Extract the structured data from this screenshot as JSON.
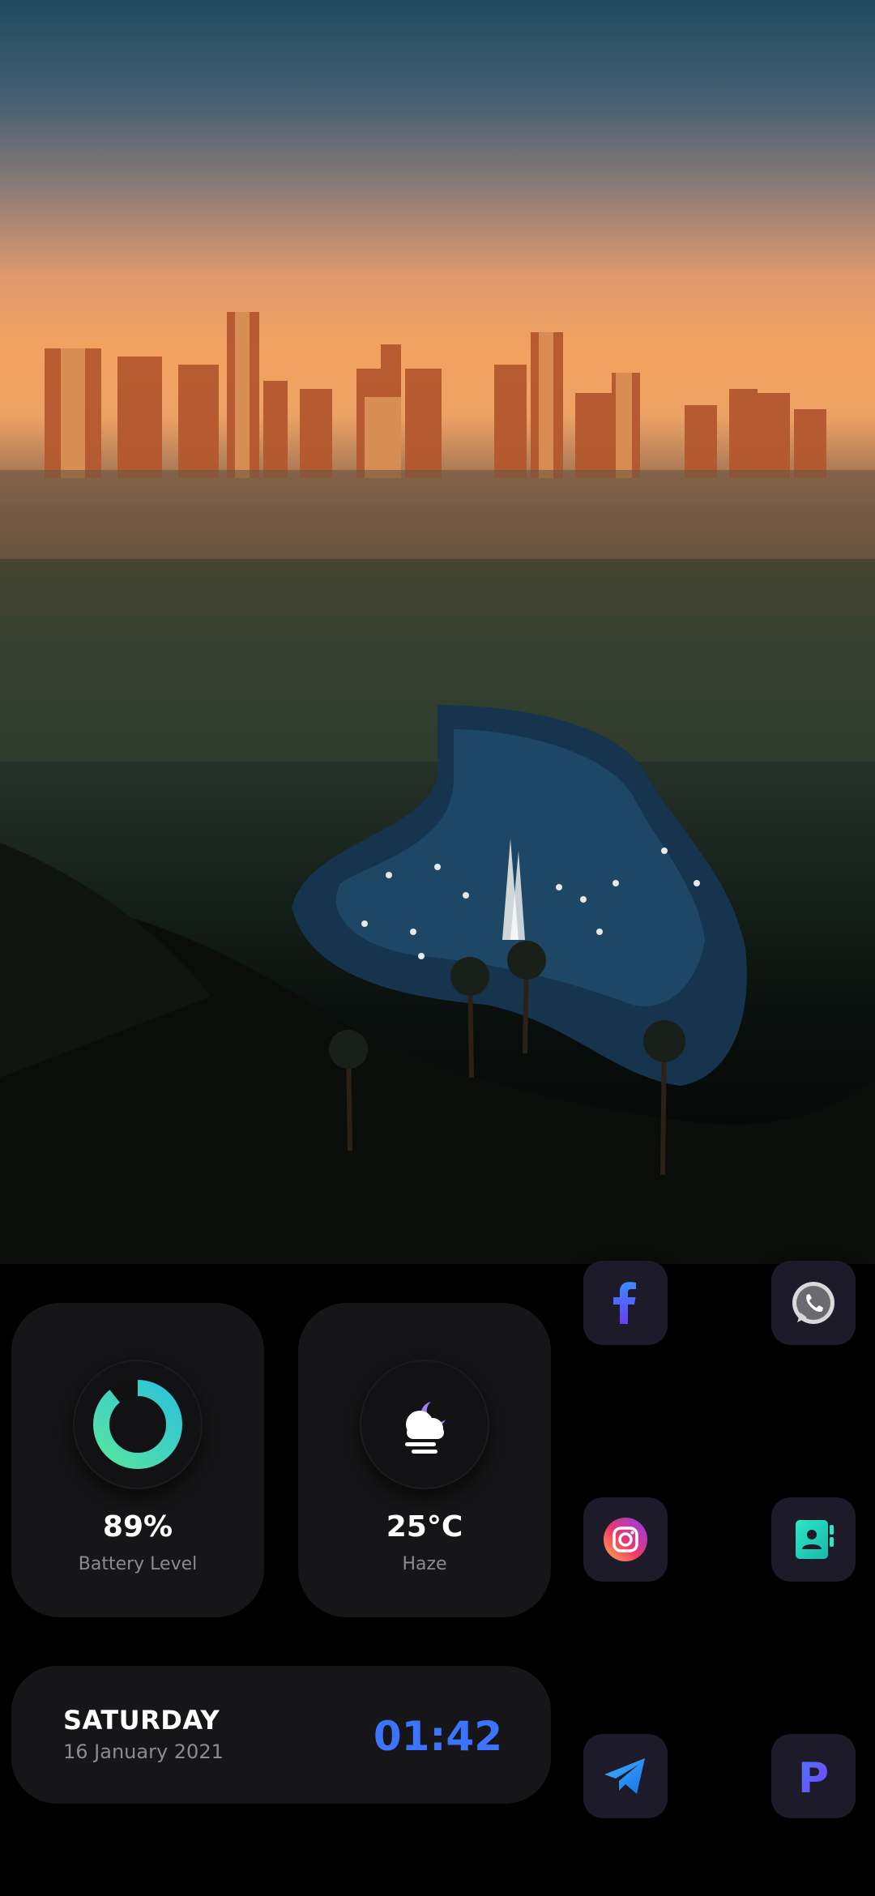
{
  "widgets": {
    "battery": {
      "percent_text": "89%",
      "label": "Battery Level",
      "level": 0.89,
      "accent_from": "#57e3a2",
      "accent_to": "#2ec3d9"
    },
    "weather": {
      "temp": "25°C",
      "condition": "Haze",
      "icon": "cloud-moon-haze-icon"
    },
    "datetime": {
      "day": "SATURDAY",
      "date": "16 January 2021",
      "time": "01:42",
      "time_color": "#3a74ff"
    }
  },
  "apps": [
    {
      "name": "Facebook",
      "icon": "facebook-icon"
    },
    {
      "name": "WhatsApp",
      "icon": "whatsapp-icon"
    },
    {
      "name": "Instagram",
      "icon": "instagram-icon"
    },
    {
      "name": "Contacts",
      "icon": "contacts-icon"
    },
    {
      "name": "Telegram",
      "icon": "telegram-icon"
    },
    {
      "name": "P App",
      "icon": "p-app-icon",
      "letter": "P"
    }
  ]
}
